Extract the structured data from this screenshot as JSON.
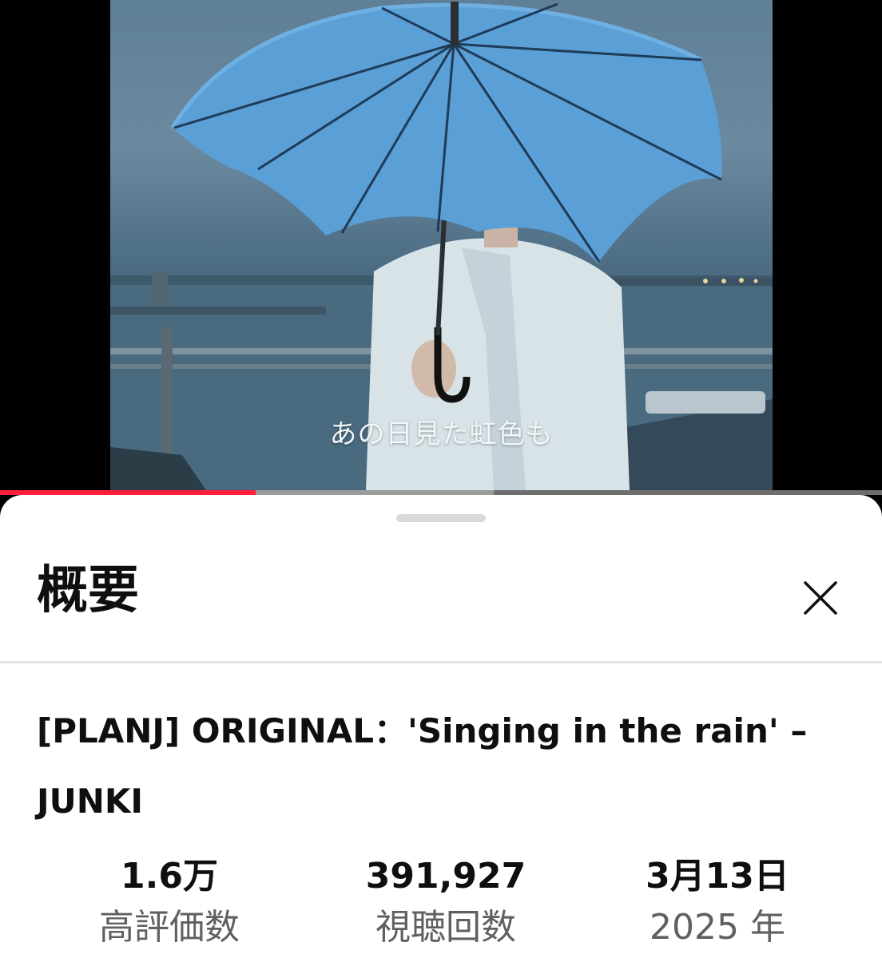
{
  "video": {
    "subtitle": "あの日見た虹色も",
    "progress": 0.29,
    "buffered": 0.56
  },
  "colors": {
    "progress": "#ff1f3a",
    "umbrella": "#5a9fd6",
    "sheet_bg": "#ffffff",
    "primary_text": "#0f0f0f",
    "secondary_text": "#606060"
  },
  "sheet": {
    "title": "概要",
    "close_icon": "close-icon",
    "video_title_line1": "[PLANJ] ORIGINAL：'Singing in the rain' –",
    "video_title_line2": "JUNKI",
    "stats": [
      {
        "value": "1.6万",
        "label": "高評価数"
      },
      {
        "value": "391,927",
        "label": "視聴回数"
      },
      {
        "value": "3月13日",
        "label": "2025 年"
      }
    ]
  }
}
